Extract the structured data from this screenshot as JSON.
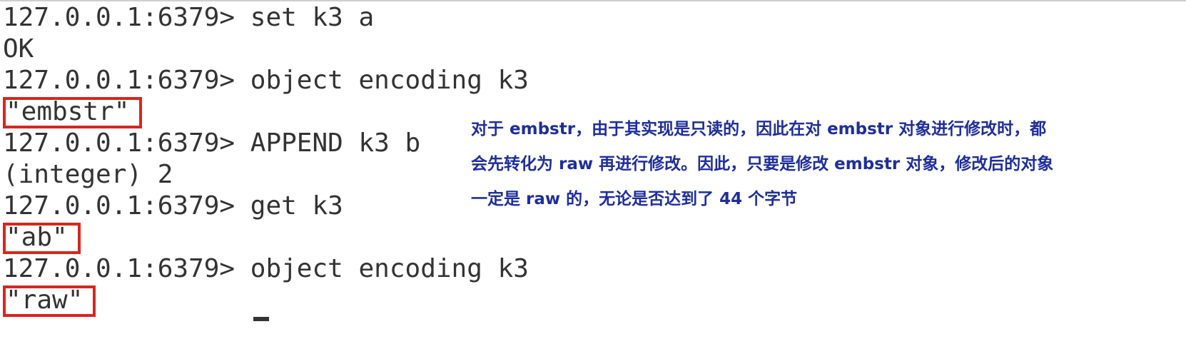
{
  "terminal": {
    "lines": [
      {
        "prompt": "127.0.0.1:6379> ",
        "command": "set k3 a"
      },
      {
        "output": "OK"
      },
      {
        "prompt": "127.0.0.1:6379> ",
        "command": "object encoding k3"
      },
      {
        "output": "\"embstr\"",
        "highlighted": true
      },
      {
        "prompt": "127.0.0.1:6379> ",
        "command": "APPEND k3 b"
      },
      {
        "output": "(integer) 2"
      },
      {
        "prompt": "127.0.0.1:6379> ",
        "command": "get k3"
      },
      {
        "output": "\"ab\"",
        "highlighted": true
      },
      {
        "prompt": "127.0.0.1:6379> ",
        "command": "object encoding k3"
      },
      {
        "output": "\"raw\"",
        "highlighted": true
      }
    ]
  },
  "annotation": {
    "line1": "对于 embstr，由于其实现是只读的，因此在对 embstr 对象进行修改时，都",
    "line2": "会先转化为 raw 再进行修改。因此，只要是修改 embstr 对象，修改后的对象",
    "line3": "一定是 raw 的，无论是否达到了 44 个字节"
  },
  "colors": {
    "text": "#333333",
    "highlight_border": "#d9251d",
    "annotation_text": "#1e2e9c"
  }
}
